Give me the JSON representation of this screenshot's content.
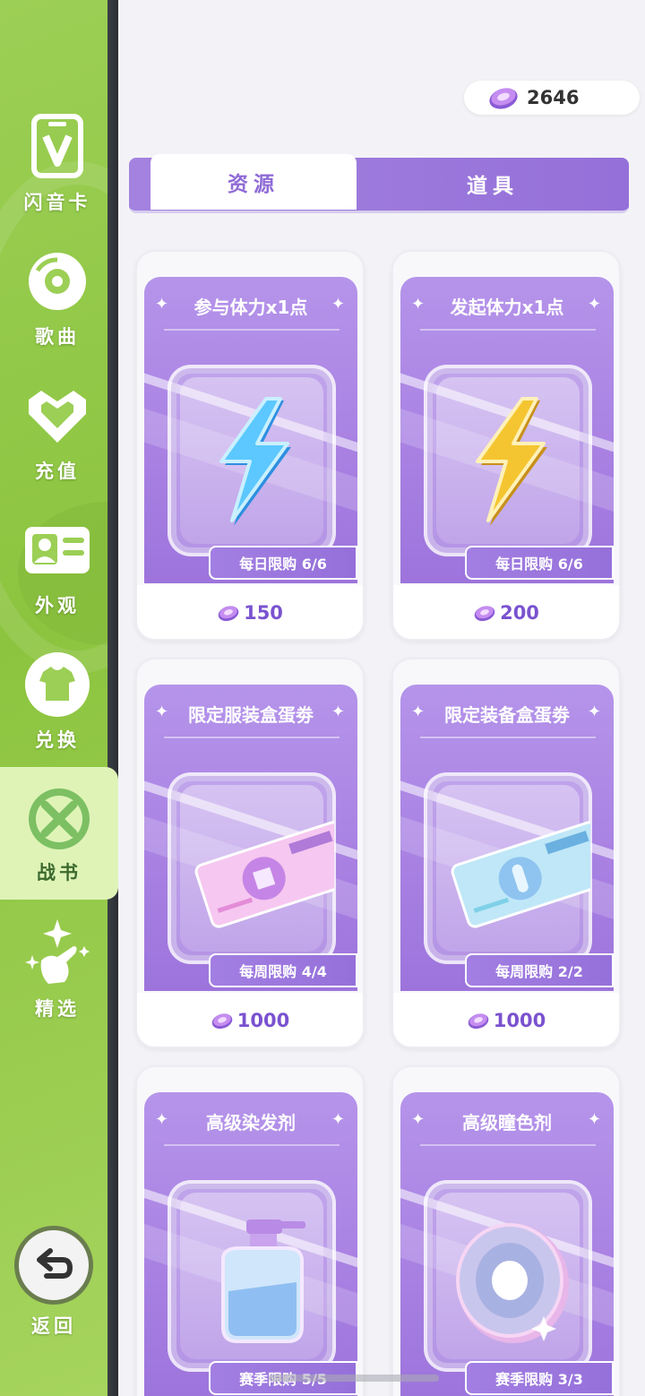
{
  "sidebar": {
    "items": [
      {
        "label": "闪音卡",
        "icon": "card-v-icon"
      },
      {
        "label": "歌曲",
        "icon": "disc-icon"
      },
      {
        "label": "充值",
        "icon": "heart-icon"
      },
      {
        "label": "外观",
        "icon": "id-card-icon"
      },
      {
        "label": "兑换",
        "icon": "tshirt-icon"
      },
      {
        "label": "战书",
        "icon": "crossed-swords-icon",
        "active": true
      },
      {
        "label": "精选",
        "icon": "sparkle-hand-icon"
      }
    ],
    "back_label": "返回"
  },
  "currency": {
    "amount": "2646",
    "icon": "gem-coin-icon"
  },
  "tabs": [
    {
      "label": "资源",
      "active": true
    },
    {
      "label": "道具",
      "active": false
    }
  ],
  "products": [
    {
      "title": "参与体力x1点",
      "limit": "每日限购 6/6",
      "price": "150",
      "icon": "blue-lightning-icon"
    },
    {
      "title": "发起体力x1点",
      "limit": "每日限购 6/6",
      "price": "200",
      "icon": "gold-lightning-icon"
    },
    {
      "title": "限定服装盒蛋劵",
      "limit": "每周限购 4/4",
      "price": "1000",
      "icon": "pink-ticket-icon"
    },
    {
      "title": "限定装备盒蛋劵",
      "limit": "每周限购 2/2",
      "price": "1000",
      "icon": "cyan-ticket-icon"
    },
    {
      "title": "高级染发剂",
      "limit": "赛季限购 5/5",
      "price": "",
      "icon": "spray-bottle-icon"
    },
    {
      "title": "高级瞳色剂",
      "limit": "赛季限购 3/3",
      "price": "",
      "icon": "contact-lens-icon"
    }
  ],
  "colors": {
    "sidebar_green": "#8cc43f",
    "accent_purple": "#9d74dc",
    "price_purple": "#7a52cf"
  }
}
